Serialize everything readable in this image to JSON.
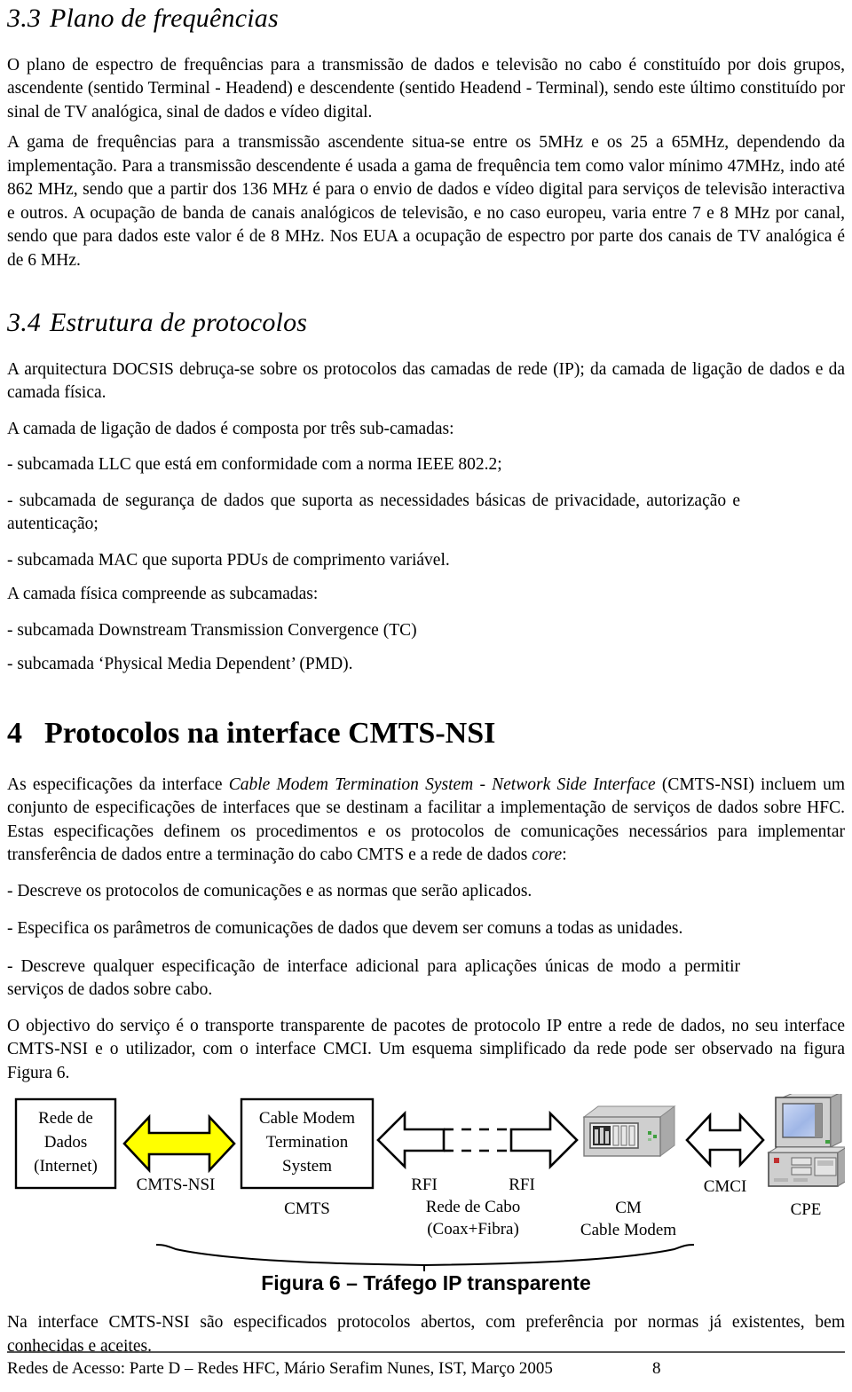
{
  "document": {
    "section_33": {
      "number": "3.3",
      "title": "Plano de frequências",
      "paragraphs": [
        "O plano de espectro de frequências para a transmissão de dados e televisão no cabo é constituído por dois grupos, ascendente (sentido Terminal - Headend) e descendente (sentido Headend - Terminal), sendo este último constituído por sinal de TV analógica, sinal de dados e vídeo digital.",
        "A gama de frequências para a transmissão ascendente situa-se entre os 5MHz e os 25 a 65MHz, dependendo da implementação. Para a transmissão descendente é usada a gama de frequência tem como valor mínimo 47MHz, indo até 862 MHz, sendo que a partir dos 136 MHz é para o envio de dados e vídeo digital para serviços de televisão interactiva e outros. A ocupação de banda de canais analógicos de televisão, e no caso europeu, varia entre 7 e 8 MHz por canal, sendo que para dados este valor é de 8 MHz. Nos EUA a ocupação de espectro por parte dos canais de TV analógica é de 6 MHz."
      ]
    },
    "section_34": {
      "number": "3.4",
      "title": "Estrutura de protocolos",
      "intro": "A arquitectura DOCSIS debruça-se sobre os protocolos das camadas de rede (IP); da camada de ligação de dados e da camada física.",
      "link_layer_lead": "A camada de ligação de dados é composta por três sub-camadas:",
      "link_layer_items": [
        "- subcamada LLC que está em conformidade com a norma IEEE 802.2;",
        "- subcamada de segurança de dados que suporta as necessidades básicas de privacidade, autorização e autenticação;",
        "- subcamada MAC que suporta PDUs de comprimento variável."
      ],
      "phy_layer_lead": "A camada física compreende as subcamadas:",
      "phy_layer_items": [
        "- subcamada Downstream Transmission Convergence (TC)",
        "- subcamada ‘Physical Media Dependent’ (PMD)."
      ]
    },
    "chapter_4": {
      "number": "4",
      "title": "Protocolos na interface CMTS-NSI",
      "paragraph_1_part1": "As especificações da interface ",
      "paragraph_1_italic": "Cable Modem Termination System - Network Side Interface",
      "paragraph_1_part2": " (CMTS-NSI) incluem um conjunto de especificações de interfaces que se destinam a facilitar a implementação de serviços de dados sobre HFC. Estas especificações definem os procedimentos e os protocolos de comunicações necessários para implementar transferência de dados entre a terminação do cabo CMTS e a rede de dados ",
      "paragraph_1_italic2": "core",
      "paragraph_1_part3": ":",
      "bullets": [
        "- Descreve os protocolos de comunicações e as normas que serão aplicados.",
        "- Especifica os parâmetros de comunicações de dados que devem ser comuns a todas as unidades.",
        "- Descreve qualquer especificação de interface adicional para aplicações únicas de modo a permitir serviços de dados sobre cabo."
      ],
      "paragraph_2": "O objectivo do serviço é o transporte transparente de pacotes de protocolo IP entre a rede de dados, no seu interface CMTS-NSI e o utilizador, com o interface CMCI. Um esquema simplificado da rede pode ser observado na figura Figura 6.",
      "closing_paragraph": "Na interface CMTS-NSI são especificados protocolos abertos, com preferência por normas já existentes, bem conhecidas e aceites."
    },
    "figure": {
      "caption": "Figura 6 – Tráfego IP transparente",
      "nodes": {
        "data_network": [
          "Rede de",
          "Dados",
          "(Internet)"
        ],
        "cmts_box": [
          "Cable Modem",
          "Termination",
          "System"
        ],
        "cmts_label": "CMTS",
        "cm_label_1": "CM",
        "cm_label_2": "Cable Modem",
        "cpe_label": "CPE"
      },
      "interfaces": {
        "cmts_nsi": "CMTS-NSI",
        "rfi_left": "RFI",
        "rfi_right": "RFI",
        "cable_network_1": "Rede de Cabo",
        "cable_network_2": "(Coax+Fibra)",
        "cmci": "CMCI"
      },
      "colors": {
        "arrow_highlight": "#FFFF00",
        "outline": "#000000",
        "device_body": "#C0C0C0",
        "device_light": "#E0E0E0",
        "screen": "#A8BEE8"
      }
    },
    "footer": {
      "text": "Redes de Acesso: Parte D – Redes HFC, Mário Serafim Nunes, IST, Março 2005",
      "page": "8"
    }
  }
}
